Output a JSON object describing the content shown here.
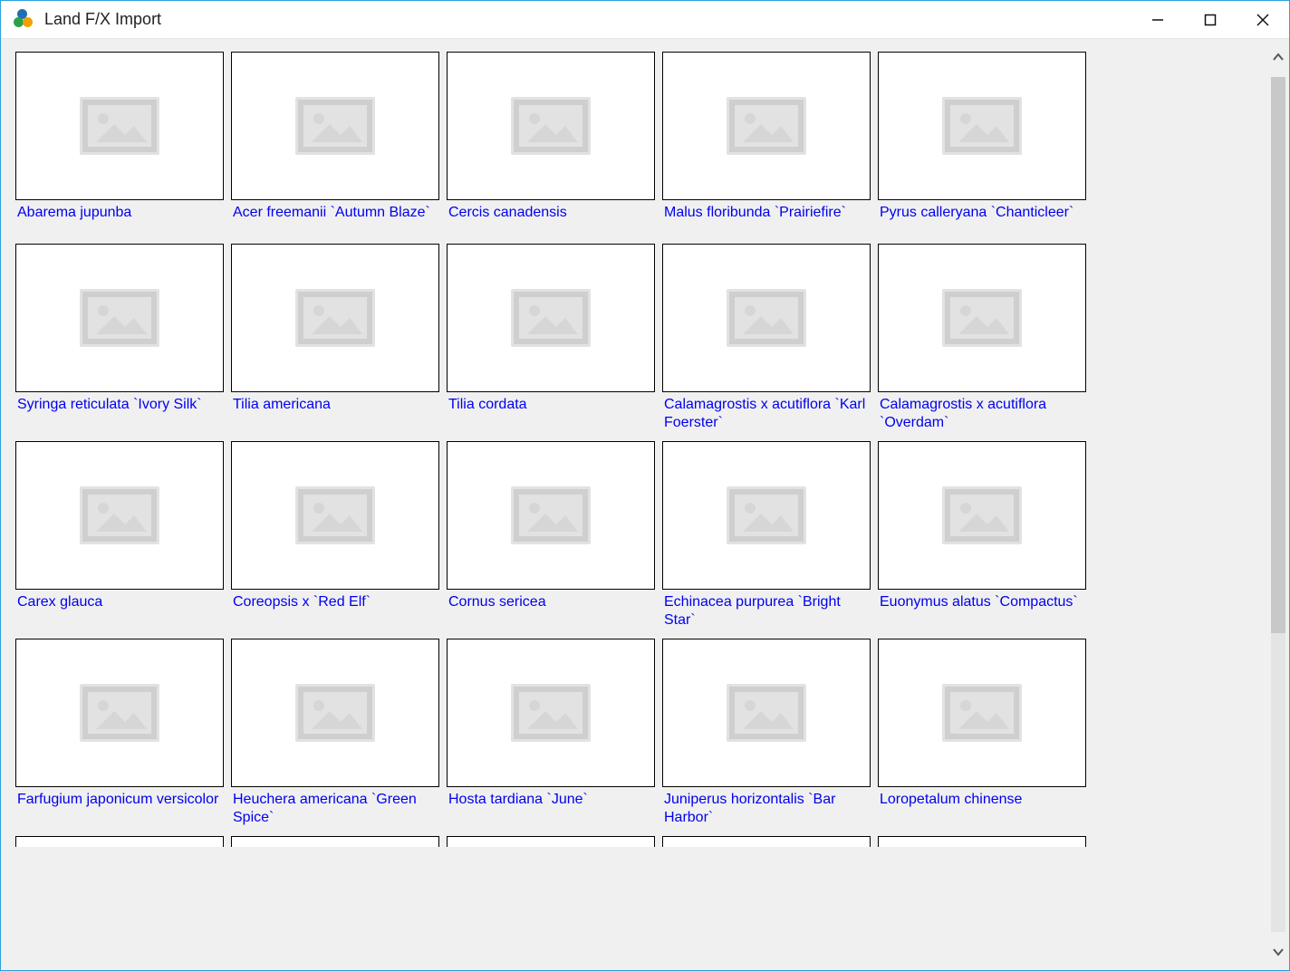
{
  "window": {
    "title": "Land F/X Import"
  },
  "items": [
    {
      "label": "Abarema jupunba"
    },
    {
      "label": "Acer freemanii `Autumn Blaze`"
    },
    {
      "label": "Cercis canadensis"
    },
    {
      "label": "Malus floribunda `Prairiefire`"
    },
    {
      "label": "Pyrus calleryana `Chanticleer`"
    },
    {
      "label": "Syringa reticulata `Ivory Silk`"
    },
    {
      "label": "Tilia americana"
    },
    {
      "label": "Tilia cordata"
    },
    {
      "label": "Calamagrostis x acutiflora `Karl Foerster`"
    },
    {
      "label": "Calamagrostis x acutiflora `Overdam`"
    },
    {
      "label": "Carex glauca"
    },
    {
      "label": "Coreopsis x `Red Elf`"
    },
    {
      "label": "Cornus sericea"
    },
    {
      "label": "Echinacea purpurea `Bright Star`"
    },
    {
      "label": "Euonymus alatus `Compactus`"
    },
    {
      "label": "Farfugium japonicum versicolor"
    },
    {
      "label": "Heuchera americana `Green Spice`"
    },
    {
      "label": "Hosta tardiana `June`"
    },
    {
      "label": "Juniperus horizontalis `Bar Harbor`"
    },
    {
      "label": "Loropetalum chinense"
    }
  ]
}
